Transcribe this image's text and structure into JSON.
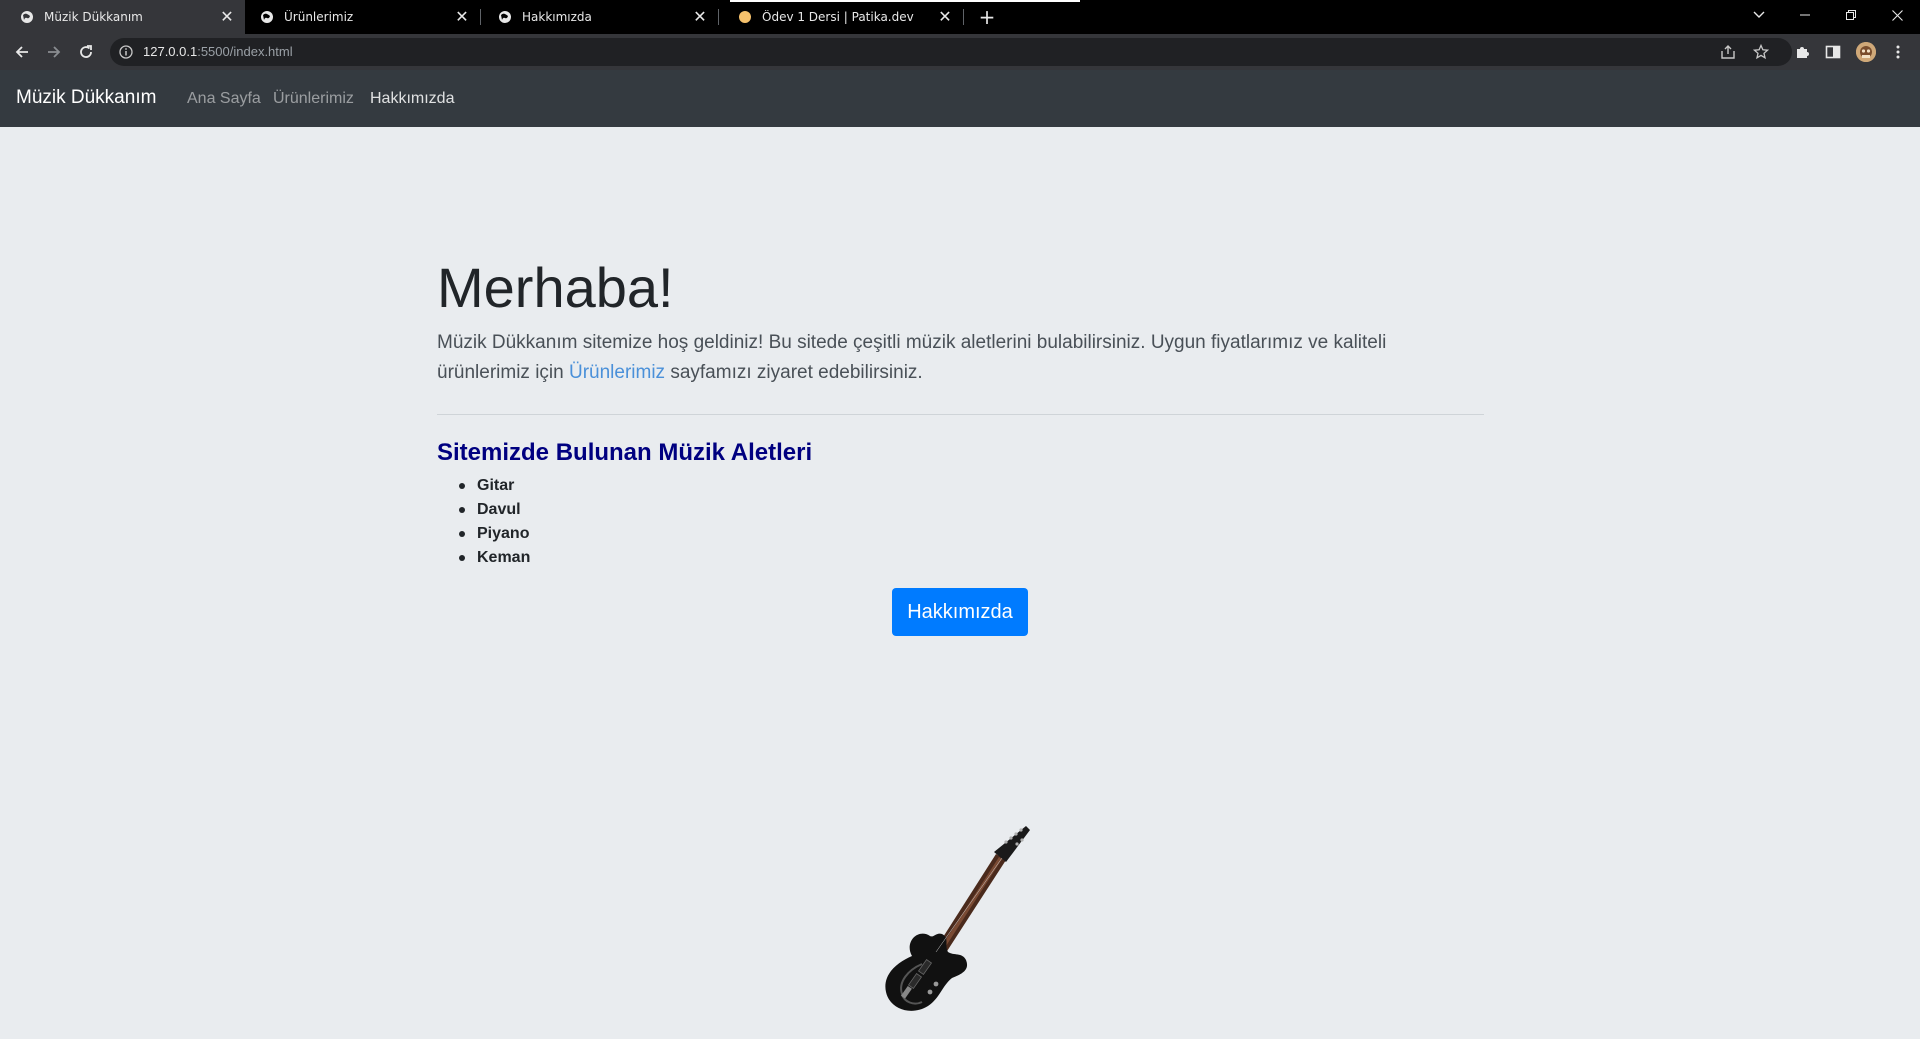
{
  "browser": {
    "tabs": [
      {
        "title": "Müzik Dükkanım",
        "active": true,
        "icon": "globe-icon"
      },
      {
        "title": "Ürünlerimiz",
        "active": false,
        "icon": "globe-icon"
      },
      {
        "title": "Hakkımızda",
        "active": false,
        "icon": "globe-icon"
      },
      {
        "title": "Ödev 1 Dersi | Patika.dev",
        "active": false,
        "icon": "patika-favicon"
      }
    ],
    "url_host": "127.0.0.1",
    "url_rest": ":5500/index.html"
  },
  "navbar": {
    "brand": "Müzik Dükkanım",
    "links": [
      {
        "label": "Ana Sayfa",
        "active": false
      },
      {
        "label": "Ürünlerimiz",
        "active": false
      },
      {
        "label": "Hakkımızda",
        "active": true
      }
    ]
  },
  "hero": {
    "title": "Merhaba!",
    "lead_before": "Müzik Dükkanım sitemize hoş geldiniz! Bu sitede çeşitli müzik aletlerini bulabilirsiniz. Uygun fiyatlarımız ve kaliteli ürünlerimiz için ",
    "lead_link": "Ürünlerimiz",
    "lead_after": " sayfamızı ziyaret edebilirsiniz."
  },
  "instruments": {
    "heading": "Sitemizde Bulunan Müzik Aletleri",
    "items": [
      "Gitar",
      "Davul",
      "Piyano",
      "Keman"
    ]
  },
  "button": {
    "label": "Hakkımızda"
  },
  "image": {
    "subject": "electric-guitar-image"
  },
  "colors": {
    "navbar_bg": "#343a40",
    "page_bg": "#e9ecef",
    "primary": "#007bff",
    "heading": "#000080",
    "link": "#4a90d9"
  }
}
